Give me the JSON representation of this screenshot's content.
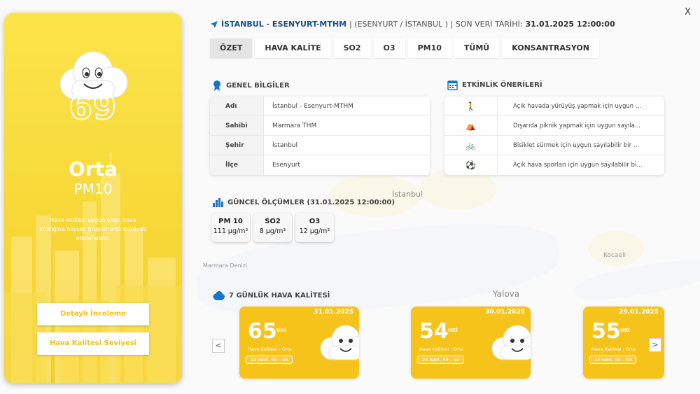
{
  "header": {
    "location": "İSTANBUL - ESENYURT-MTHM",
    "district": "| (ESENYURT / İSTANBUL ) | SON VERİ TARİHİ:",
    "last_date": "31.01.2025 12:00:00"
  },
  "close_label": "X",
  "tabs": [
    "ÖZET",
    "HAVA KALİTE",
    "SO2",
    "O3",
    "PM10",
    "TÜMÜ",
    "KONSANTRASYON"
  ],
  "card": {
    "aqi": "69",
    "level": "Orta",
    "pollutant": "PM10",
    "description": "Hava kalitesi uygun olup, hava kirliliğine hassas gruplar orta düzeyde etkilenebilir.",
    "detail_button": "Detaylı İnceleme",
    "level_button": "Hava Kalitesi Seviyesi"
  },
  "general": {
    "title": "GENEL BİLGİLER",
    "rows": [
      {
        "k": "Adı",
        "v": "İstanbul - Esenyurt-MTHM"
      },
      {
        "k": "Sahibi",
        "v": "Marmara THM"
      },
      {
        "k": "Şehir",
        "v": "İstanbul"
      },
      {
        "k": "İlçe",
        "v": "Esenyurt"
      }
    ]
  },
  "activities": {
    "title": "ETKİNLİK ÖNERİLERİ",
    "rows": [
      {
        "icon": "walking-icon",
        "text": "Açık havada yürüyüş yapmak için uygun ..."
      },
      {
        "icon": "picnic-icon",
        "text": "Dışarıda piknik yapmak için uygun sayıla..."
      },
      {
        "icon": "bicycle-icon",
        "text": "Bisiklet sürmek için uygun sayılabilir bir ..."
      },
      {
        "icon": "ball-icon",
        "text": "Açık hava sporları için uygun sayılabilir bi..."
      }
    ]
  },
  "measurements": {
    "title": "GÜNCEL ÖLÇÜMLER (31.01.2025 12:00:00)",
    "items": [
      {
        "name": "PM 10",
        "value": "111 µg/m³"
      },
      {
        "name": "SO2",
        "value": "8 µg/m³"
      },
      {
        "name": "O3",
        "value": "12 µg/m³"
      }
    ]
  },
  "weekly": {
    "title": "7 GÜNLÜK HAVA KALİTESİ",
    "days": [
      {
        "date": "31.01.2025",
        "value": "65",
        "unit": "HKİ",
        "label": "Hava Kalitesi : Orta",
        "count": "13 Adet, 68 – 69"
      },
      {
        "date": "30.01.2025",
        "value": "54",
        "unit": "HKİ",
        "label": "Hava Kalitesi : Orta",
        "count": "24 Adet, 49 – 58"
      },
      {
        "date": "29.01.2025",
        "value": "55",
        "unit": "HKİ",
        "label": "Hava Kalitesi : Orta",
        "count": "24 Adet, 50 – 59"
      }
    ],
    "prev": "<",
    "next": ">"
  },
  "map_labels": [
    "İstanbul",
    "Yalova",
    "Marmara Denizi",
    "Kocaeli"
  ],
  "colors": {
    "accent": "#f6c31a",
    "card": "#f8d93a"
  }
}
